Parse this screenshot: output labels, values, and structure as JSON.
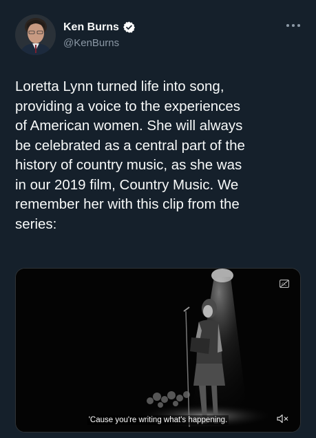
{
  "author": {
    "name": "Ken Burns",
    "handle": "@KenBurns"
  },
  "tweet": {
    "text": "Loretta Lynn turned life into song,\nproviding a voice to the experiences\nof American women. She will always\nbe celebrated as a central part of the\nhistory of country music, as she was\nin our 2019 film, Country Music. We\nremember her with this clip from the\nseries:"
  },
  "media": {
    "subtitle": "'Cause you're writing what's happening.",
    "icons": [
      "closed-captions-icon",
      "muted-speaker-icon"
    ]
  },
  "icons": [
    "verified-badge-icon",
    "more-options-icon",
    "avatar"
  ],
  "colors": {
    "background": "#15202b",
    "text": "#f7f9f9",
    "secondary_text": "#8b98a5",
    "verified_badge": "#ffffff"
  }
}
